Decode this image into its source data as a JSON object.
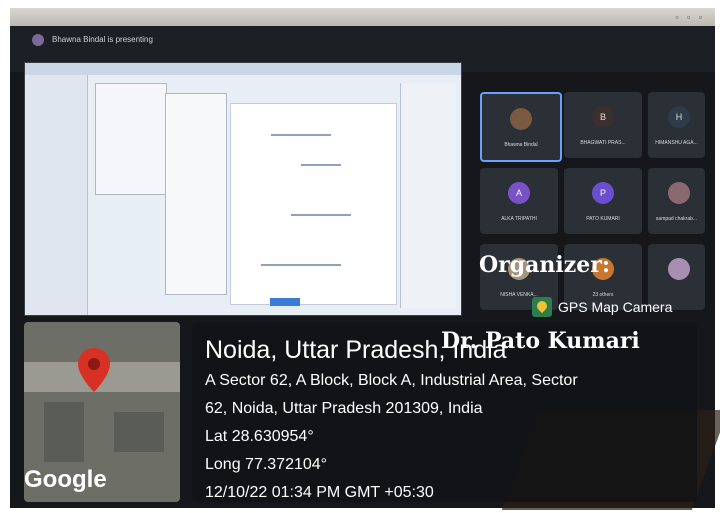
{
  "meeting": {
    "presenter_text": "Bhawna Bindal is presenting"
  },
  "participants": [
    {
      "name": "Bhawna Bindal",
      "initial": "",
      "color": "#7a5a40",
      "active": true
    },
    {
      "name": "BHAGWATI PRAS...",
      "initial": "B",
      "color": "#3b2f2f",
      "active": false
    },
    {
      "name": "HIMANSHU AGA...",
      "initial": "H",
      "color": "#2f3a4a",
      "active": false
    },
    {
      "name": "ALKA TRIPATHI",
      "initial": "A",
      "color": "#7a52c7",
      "active": false
    },
    {
      "name": "PATO KUMARI",
      "initial": "P",
      "color": "#6a4fd1",
      "active": false
    },
    {
      "name": "sampad chakrab...",
      "initial": "",
      "color": "#8a6a70",
      "active": false
    },
    {
      "name": "NISHA VENKA...",
      "initial": "",
      "color": "#a59580",
      "active": false
    },
    {
      "name": "23 others",
      "initial": "",
      "color": "#c9762e",
      "active": false
    },
    {
      "name": "",
      "initial": "",
      "color": "#a88fb2",
      "active": false
    }
  ],
  "overlay": {
    "organizer_label": "Organizer:",
    "organizer_name": "Dr. Pato Kumari"
  },
  "gps": {
    "brand": "GPS Map Camera",
    "map_provider": "Google",
    "place_title": "Noida, Uttar Pradesh, India",
    "address_line1": "A Sector 62, A Block, Block A, Industrial Area, Sector",
    "address_line2": "62, Noida, Uttar Pradesh 201309, India",
    "lat": "Lat 28.630954°",
    "long": "Long 77.372104°",
    "timestamp": "12/10/22 01:34 PM GMT +05:30",
    "pin_color": "#d93025"
  },
  "icons": [
    "location-pin-icon",
    "gps-map-camera-logo-icon"
  ]
}
